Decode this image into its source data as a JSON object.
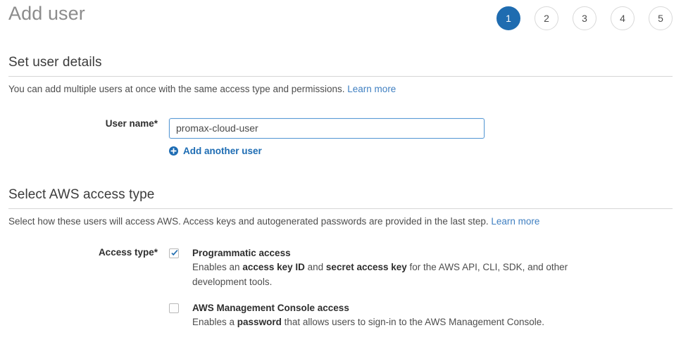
{
  "header": {
    "title": "Add user",
    "steps": [
      {
        "label": "1",
        "active": true
      },
      {
        "label": "2",
        "active": false
      },
      {
        "label": "3",
        "active": false
      },
      {
        "label": "4",
        "active": false
      },
      {
        "label": "5",
        "active": false
      }
    ]
  },
  "user_details": {
    "heading": "Set user details",
    "description": "You can add multiple users at once with the same access type and permissions.",
    "learn_more": "Learn more",
    "username_label": "User name*",
    "username_value": "promax-cloud-user",
    "username_placeholder": "",
    "add_another_user": "Add another user",
    "add_icon": "plus-circle-icon"
  },
  "access_type": {
    "heading": "Select AWS access type",
    "description": "Select how these users will access AWS. Access keys and autogenerated passwords are provided in the last step.",
    "learn_more": "Learn more",
    "label": "Access type*",
    "options": [
      {
        "title": "Programmatic access",
        "checked": true,
        "desc_part1": "Enables an ",
        "desc_bold1": "access key ID",
        "desc_part2": " and ",
        "desc_bold2": "secret access key",
        "desc_part3": " for the AWS API, CLI, SDK, and other development tools."
      },
      {
        "title": "AWS Management Console access",
        "checked": false,
        "desc_part1": "Enables a ",
        "desc_bold1": "password",
        "desc_part2": " that allows users to sign-in to the AWS Management Console.",
        "desc_bold2": "",
        "desc_part3": ""
      }
    ]
  },
  "colors": {
    "accent_blue": "#1f6cb0",
    "link_blue": "#3f7fc1",
    "check_blue": "#1f6cb0",
    "divider": "#d6d6d6",
    "title_gray": "#8c8c8c"
  }
}
